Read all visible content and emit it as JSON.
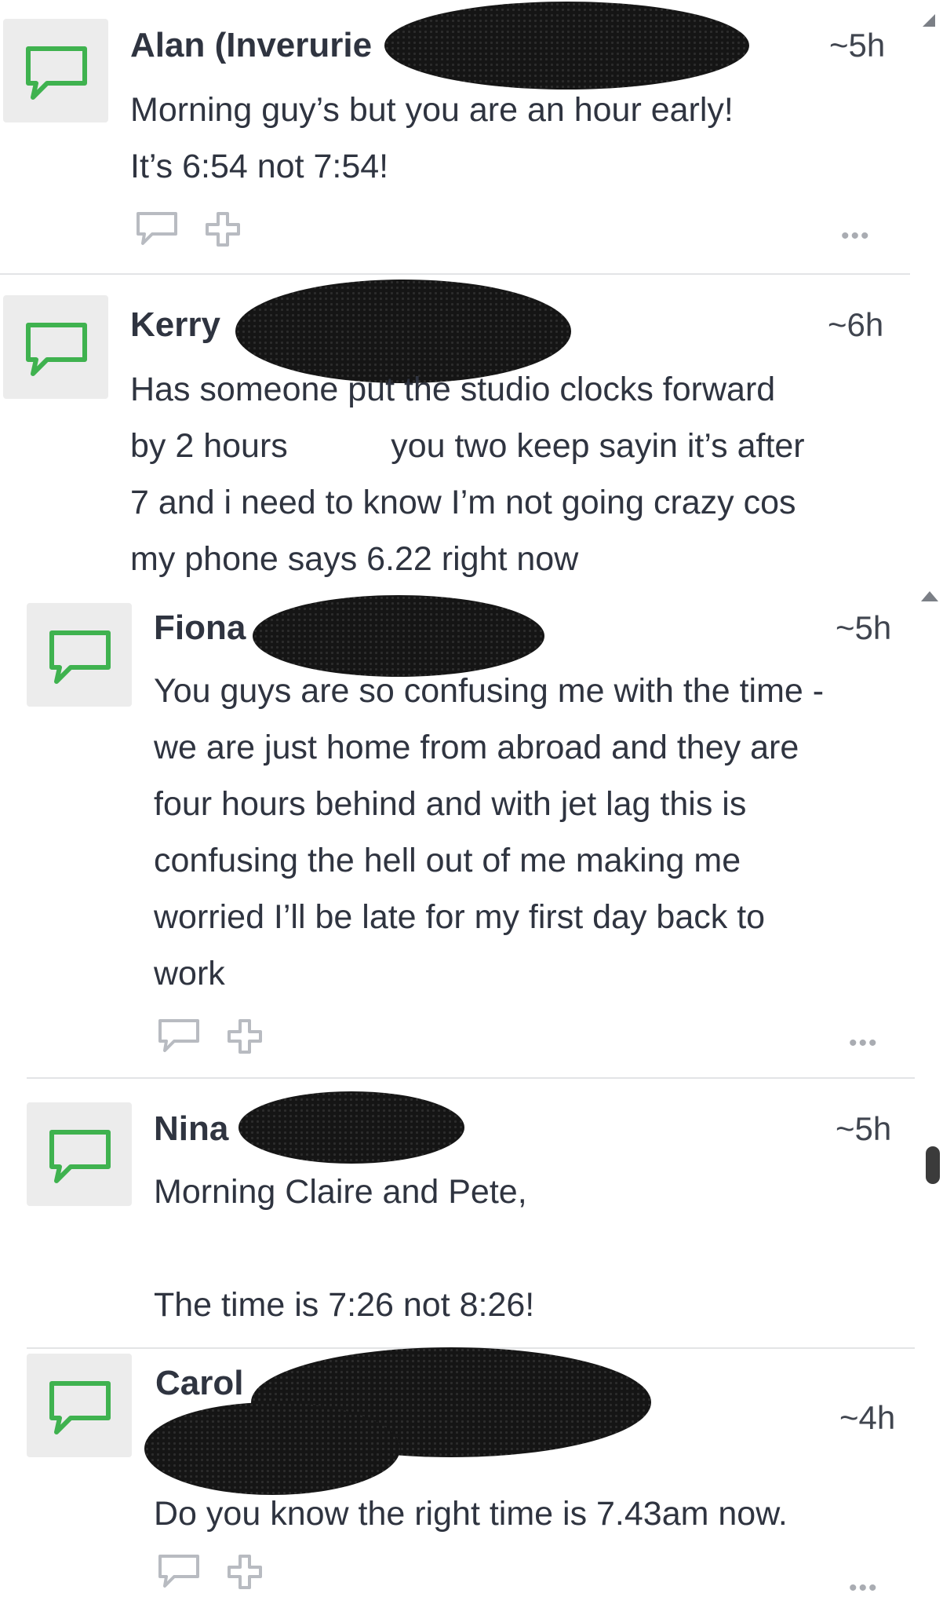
{
  "messages": [
    {
      "author": "Alan (Inverurie",
      "time": "~5h",
      "text": "Morning guy’s but you are an hour early!\nIt’s 6:54 not 7:54!",
      "more": "•••"
    },
    {
      "author": "Kerry",
      "time": "~6h",
      "text": "Has someone put the studio clocks forward\nby 2 hours           you two keep sayin it’s after\n7 and i need to know I’m not going crazy cos\nmy phone says 6.22 right now"
    },
    {
      "author": "Fiona",
      "time": "~5h",
      "text": "You guys are so confusing me with the time -\nwe are just home from abroad and they are\nfour hours behind and with jet lag this is\nconfusing the hell out of me making me\nworried I’ll be late for my first day back to\nwork",
      "more": "•••"
    },
    {
      "author": "Nina",
      "time": "~5h",
      "text": "Morning Claire and Pete,\n\nThe time is 7:26 not 8:26!"
    },
    {
      "author": "Carol",
      "time": "~4h",
      "text": "Do you know the right time is 7.43am now.",
      "more": "•••"
    }
  ],
  "colors": {
    "accent": "#3fb24f",
    "text": "#2f3440",
    "muted": "#a9acb2"
  },
  "icons": {
    "avatar": "speech-bubble-icon",
    "reply": "reply-icon",
    "add": "plus-icon",
    "scroll_up": "triangle-up-icon"
  }
}
